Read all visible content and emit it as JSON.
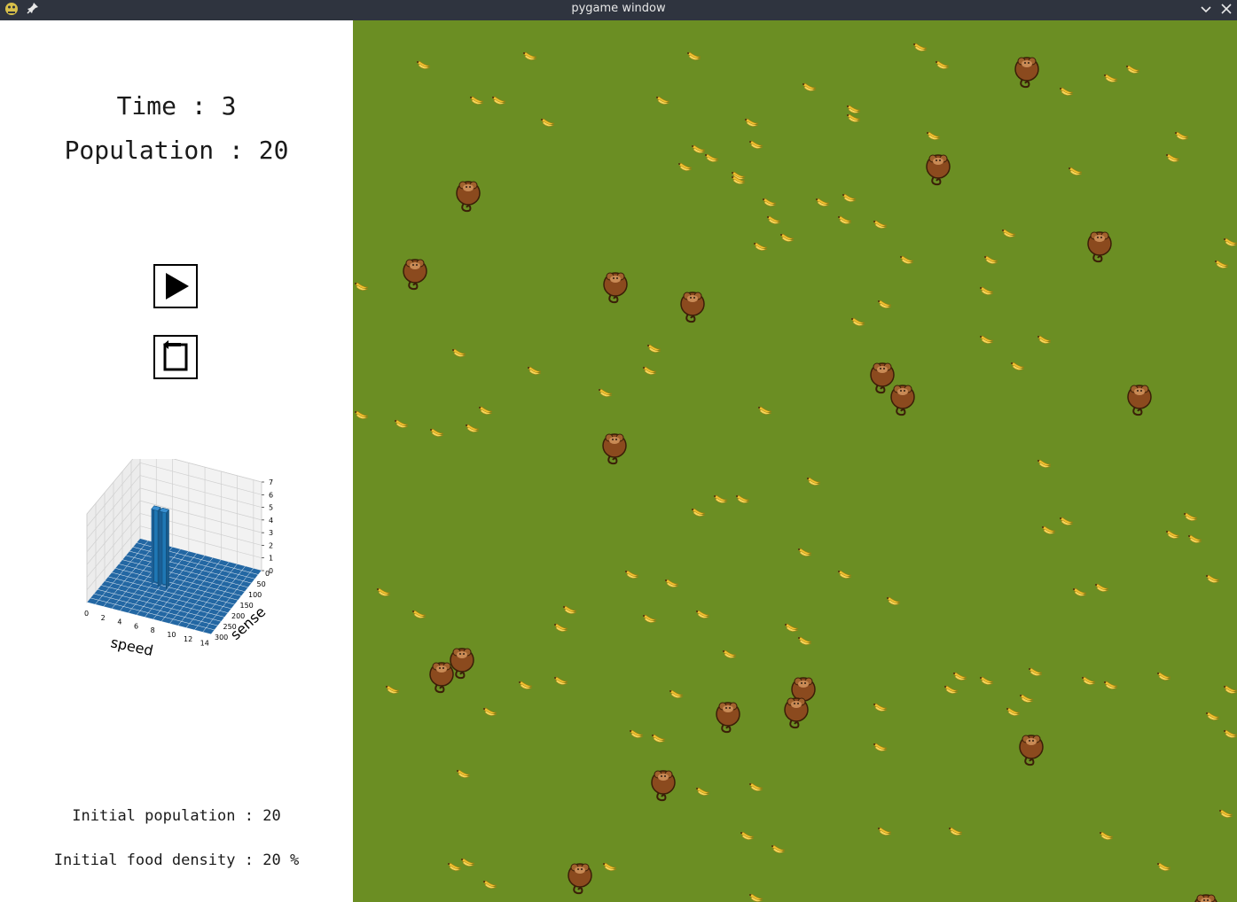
{
  "window": {
    "title": "pygame window"
  },
  "stats": {
    "time_label": "Time",
    "time_value": "3",
    "population_label": "Population",
    "population_value": "20",
    "initial_population_label": "Initial population",
    "initial_population_value": "20",
    "initial_food_density_label": "Initial food density",
    "initial_food_density_value": "20 %"
  },
  "controls": {
    "play_icon": "play-icon",
    "reset_icon": "reset-icon"
  },
  "colors": {
    "field": "#6b8e23",
    "bar": "#1f77b4",
    "titlebar": "#2f343f",
    "banana": "#f2c230",
    "monkey": "#8b4a1e"
  },
  "chart_data": {
    "type": "bar3d",
    "xlabel": "speed",
    "ylabel": "sense",
    "x_ticks": [
      "0",
      "2",
      "4",
      "6",
      "8",
      "10",
      "12",
      "14"
    ],
    "y_ticks": [
      "0",
      "50",
      "100",
      "150",
      "200",
      "250",
      "300"
    ],
    "z_ticks": [
      "0",
      "1",
      "2",
      "3",
      "4",
      "5",
      "6",
      "7"
    ],
    "xlim": [
      0,
      15
    ],
    "ylim": [
      0,
      300
    ],
    "zlim": [
      0,
      7
    ],
    "grid": true,
    "bars": [
      {
        "speed": 5,
        "sense": 160,
        "count": 6
      },
      {
        "speed": 6,
        "sense": 160,
        "count": 6
      }
    ]
  },
  "field": {
    "monkeys": [
      [
        760,
        55
      ],
      [
        660,
        165
      ],
      [
        130,
        195
      ],
      [
        842,
        252
      ],
      [
        70,
        283
      ],
      [
        296,
        298
      ],
      [
        383,
        320
      ],
      [
        597,
        400
      ],
      [
        620,
        425
      ],
      [
        887,
        425
      ],
      [
        295,
        480
      ],
      [
        123,
        722
      ],
      [
        100,
        738
      ],
      [
        508,
        755
      ],
      [
        500,
        778
      ],
      [
        423,
        783
      ],
      [
        765,
        820
      ],
      [
        350,
        860
      ],
      [
        256,
        965
      ],
      [
        962,
        1000
      ]
    ],
    "bananas": [
      [
        80,
        50
      ],
      [
        200,
        40
      ],
      [
        385,
        40
      ],
      [
        640,
        30
      ],
      [
        665,
        50
      ],
      [
        1205,
        30
      ],
      [
        880,
        55
      ],
      [
        855,
        65
      ],
      [
        515,
        75
      ],
      [
        805,
        80
      ],
      [
        140,
        90
      ],
      [
        165,
        90
      ],
      [
        350,
        90
      ],
      [
        565,
        100
      ],
      [
        565,
        110
      ],
      [
        220,
        115
      ],
      [
        450,
        115
      ],
      [
        655,
        130
      ],
      [
        935,
        130
      ],
      [
        455,
        140
      ],
      [
        390,
        145
      ],
      [
        405,
        155
      ],
      [
        375,
        165
      ],
      [
        815,
        170
      ],
      [
        435,
        175
      ],
      [
        435,
        180
      ],
      [
        925,
        155
      ],
      [
        470,
        205
      ],
      [
        530,
        205
      ],
      [
        560,
        200
      ],
      [
        475,
        225
      ],
      [
        555,
        225
      ],
      [
        595,
        230
      ],
      [
        490,
        245
      ],
      [
        460,
        255
      ],
      [
        740,
        240
      ],
      [
        625,
        270
      ],
      [
        720,
        270
      ],
      [
        990,
        250
      ],
      [
        980,
        275
      ],
      [
        10,
        300
      ],
      [
        715,
        305
      ],
      [
        600,
        320
      ],
      [
        570,
        340
      ],
      [
        715,
        360
      ],
      [
        780,
        360
      ],
      [
        340,
        370
      ],
      [
        120,
        375
      ],
      [
        335,
        395
      ],
      [
        205,
        395
      ],
      [
        750,
        390
      ],
      [
        285,
        420
      ],
      [
        10,
        445
      ],
      [
        150,
        440
      ],
      [
        55,
        455
      ],
      [
        95,
        465
      ],
      [
        135,
        460
      ],
      [
        465,
        440
      ],
      [
        780,
        500
      ],
      [
        520,
        520
      ],
      [
        390,
        555
      ],
      [
        415,
        540
      ],
      [
        440,
        540
      ],
      [
        945,
        560
      ],
      [
        805,
        565
      ],
      [
        785,
        575
      ],
      [
        925,
        580
      ],
      [
        950,
        585
      ],
      [
        510,
        600
      ],
      [
        555,
        625
      ],
      [
        970,
        630
      ],
      [
        315,
        625
      ],
      [
        360,
        635
      ],
      [
        35,
        645
      ],
      [
        610,
        655
      ],
      [
        820,
        645
      ],
      [
        845,
        640
      ],
      [
        245,
        665
      ],
      [
        75,
        670
      ],
      [
        335,
        675
      ],
      [
        395,
        670
      ],
      [
        235,
        685
      ],
      [
        495,
        685
      ],
      [
        510,
        700
      ],
      [
        425,
        715
      ],
      [
        685,
        740
      ],
      [
        715,
        745
      ],
      [
        45,
        755
      ],
      [
        195,
        750
      ],
      [
        235,
        745
      ],
      [
        675,
        755
      ],
      [
        770,
        735
      ],
      [
        830,
        745
      ],
      [
        855,
        750
      ],
      [
        915,
        740
      ],
      [
        990,
        755
      ],
      [
        365,
        760
      ],
      [
        760,
        765
      ],
      [
        745,
        780
      ],
      [
        155,
        780
      ],
      [
        595,
        775
      ],
      [
        970,
        785
      ],
      [
        990,
        805
      ],
      [
        320,
        805
      ],
      [
        345,
        810
      ],
      [
        595,
        820
      ],
      [
        125,
        850
      ],
      [
        455,
        865
      ],
      [
        395,
        870
      ],
      [
        985,
        895
      ],
      [
        600,
        915
      ],
      [
        445,
        920
      ],
      [
        680,
        915
      ],
      [
        480,
        935
      ],
      [
        850,
        920
      ],
      [
        115,
        955
      ],
      [
        130,
        950
      ],
      [
        290,
        955
      ],
      [
        915,
        955
      ],
      [
        155,
        975
      ],
      [
        165,
        1000
      ],
      [
        455,
        990
      ],
      [
        500,
        1005
      ],
      [
        735,
        1000
      ],
      [
        985,
        1000
      ]
    ]
  }
}
